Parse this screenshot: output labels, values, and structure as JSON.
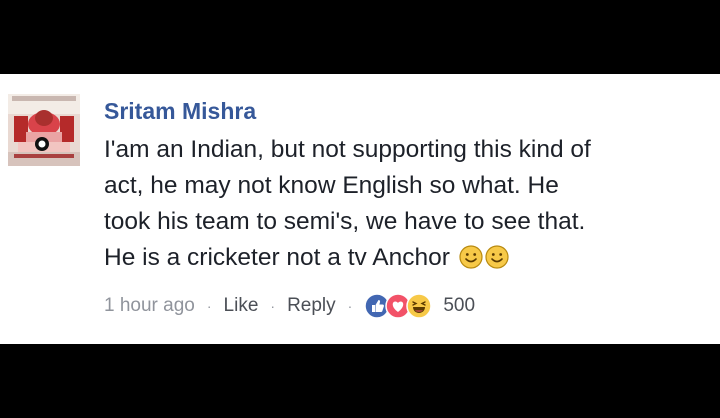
{
  "comment": {
    "author": "Sritam Mishra",
    "lines": [
      "I'am an Indian, but not supporting this kind of",
      "act, he may not know English so what. He",
      "took his team to semi's, we have to see that.",
      "He is a cricketer not a tv Anchor"
    ],
    "emojis": [
      "smiley-icon",
      "smiley-icon"
    ],
    "timestamp": "1 hour ago",
    "like_label": "Like",
    "reply_label": "Reply",
    "separator": "·",
    "reaction_icons": [
      "like-reaction-icon",
      "love-reaction-icon",
      "haha-reaction-icon"
    ],
    "reaction_count": "500"
  },
  "colors": {
    "author": "#365899",
    "text": "#1d2129",
    "meta": "#90949c",
    "like_blue": "#4267b2",
    "love_red": "#f25268",
    "emoji_yellow": "#f7c948"
  }
}
